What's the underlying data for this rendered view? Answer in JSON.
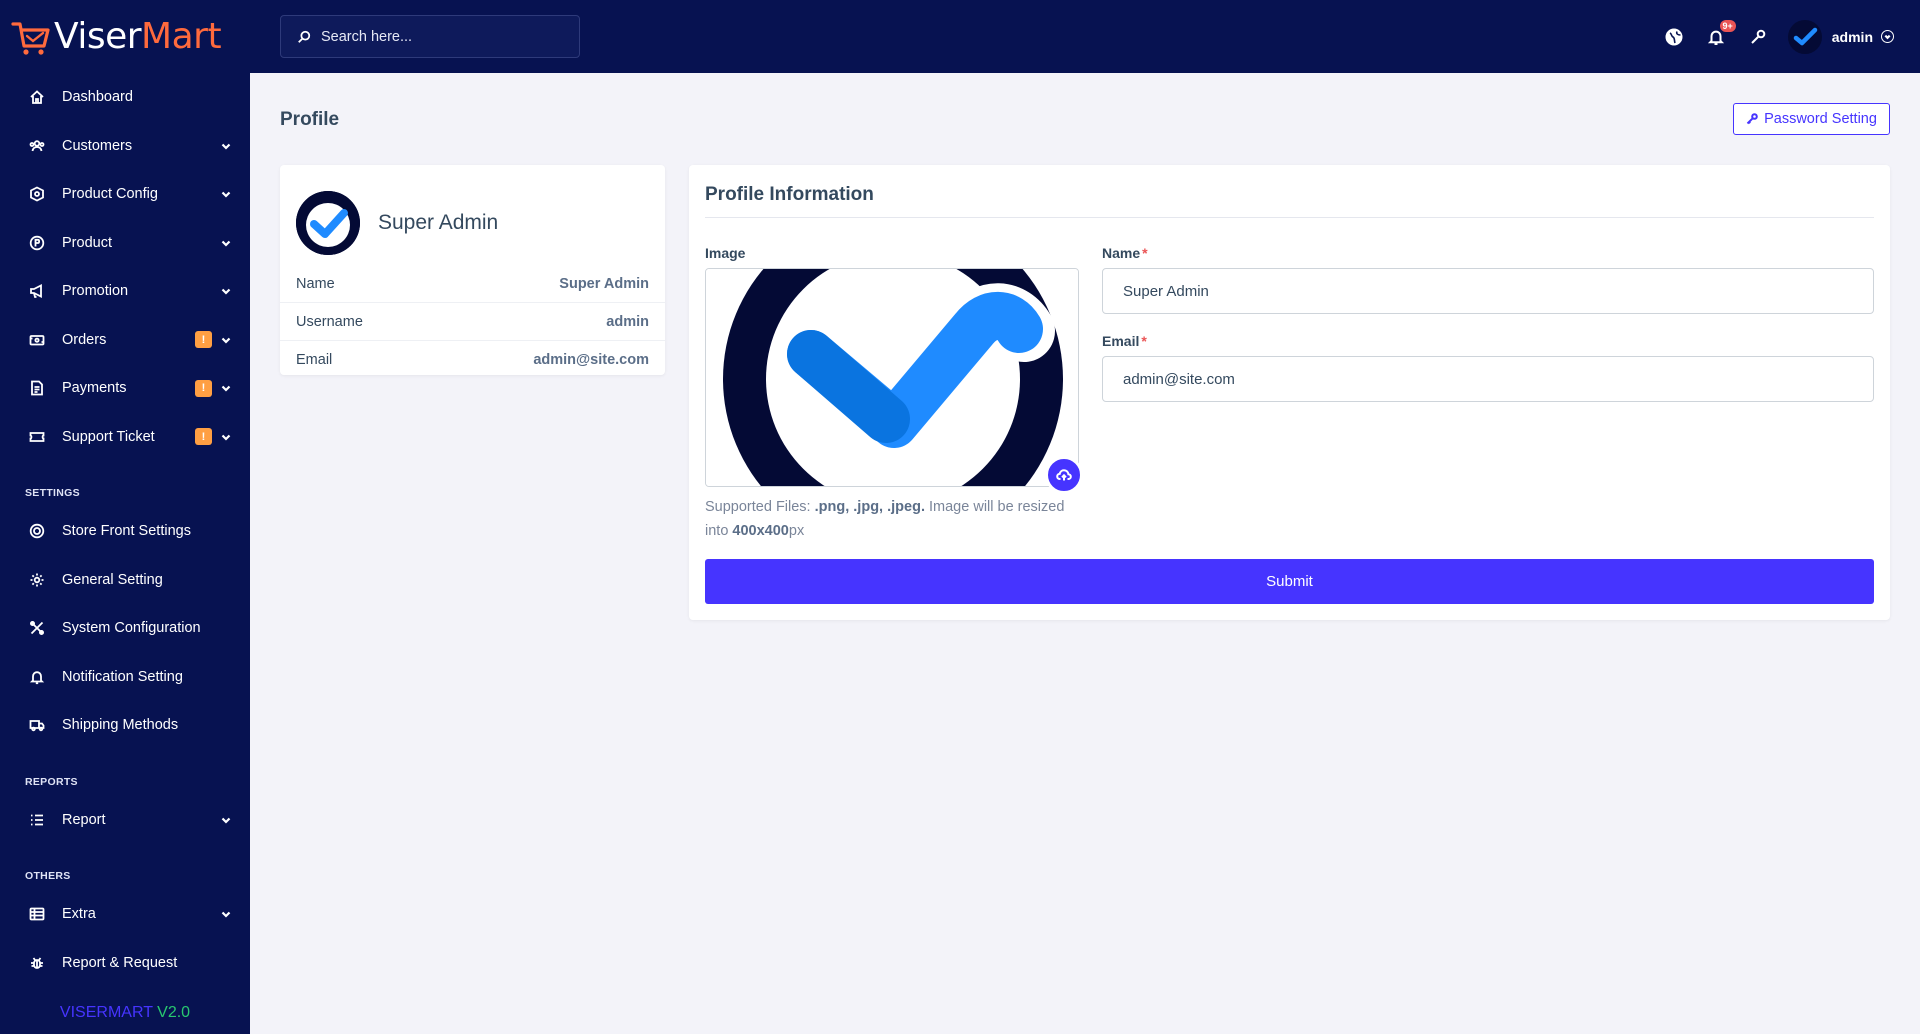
{
  "brand": {
    "name_part1": "Viser",
    "name_part2": "Mart",
    "color_accent": "#ff6a3d"
  },
  "sidebar": {
    "items": [
      {
        "label": "Dashboard",
        "icon": "home-icon"
      },
      {
        "label": "Customers",
        "icon": "users-icon",
        "expandable": true
      },
      {
        "label": "Product Config",
        "icon": "cog-box-icon",
        "expandable": true
      },
      {
        "label": "Product",
        "icon": "product-icon",
        "expandable": true
      },
      {
        "label": "Promotion",
        "icon": "megaphone-icon",
        "expandable": true
      },
      {
        "label": "Orders",
        "icon": "orders-icon",
        "badge": "!",
        "expandable": true
      },
      {
        "label": "Payments",
        "icon": "invoice-icon",
        "badge": "!",
        "expandable": true
      },
      {
        "label": "Support Ticket",
        "icon": "ticket-icon",
        "badge": "!",
        "expandable": true
      }
    ],
    "settings_heading": "SETTINGS",
    "settings_items": [
      {
        "label": "Store Front Settings",
        "icon": "circle-cog-icon"
      },
      {
        "label": "General Setting",
        "icon": "gear-icon"
      },
      {
        "label": "System Configuration",
        "icon": "tools-icon"
      },
      {
        "label": "Notification Setting",
        "icon": "bell-icon"
      },
      {
        "label": "Shipping Methods",
        "icon": "truck-icon"
      }
    ],
    "reports_heading": "REPORTS",
    "reports_items": [
      {
        "label": "Report",
        "icon": "list-icon",
        "expandable": true
      }
    ],
    "others_heading": "OTHERS",
    "others_items": [
      {
        "label": "Extra",
        "icon": "table-icon",
        "expandable": true
      },
      {
        "label": "Report & Request",
        "icon": "bug-icon"
      }
    ],
    "version_name": "VISERMART",
    "version_number": "V2.0"
  },
  "topbar": {
    "search_placeholder": "Search here...",
    "notification_count": "9+",
    "username": "admin"
  },
  "page": {
    "title": "Profile",
    "password_button": "Password Setting"
  },
  "profile_card": {
    "display_name": "Super Admin",
    "rows": [
      {
        "key": "Name",
        "value": "Super Admin"
      },
      {
        "key": "Username",
        "value": "admin"
      },
      {
        "key": "Email",
        "value": "admin@site.com"
      }
    ]
  },
  "form": {
    "title": "Profile Information",
    "image_label": "Image",
    "name_label": "Name",
    "email_label": "Email",
    "required_mark": "*",
    "name_value": "Super Admin",
    "email_value": "admin@site.com",
    "supported_prefix": "Supported Files:",
    "supported_types": ".png, .jpg, .jpeg.",
    "supported_middle": "Image will be resized into",
    "supported_size": "400x400",
    "supported_unit": "px",
    "submit_label": "Submit"
  },
  "colors": {
    "sidebar_bg": "#071251",
    "primary": "#4634ff",
    "warning_badge": "#ff9f43",
    "danger": "#ea5455",
    "success": "#28c76f"
  }
}
